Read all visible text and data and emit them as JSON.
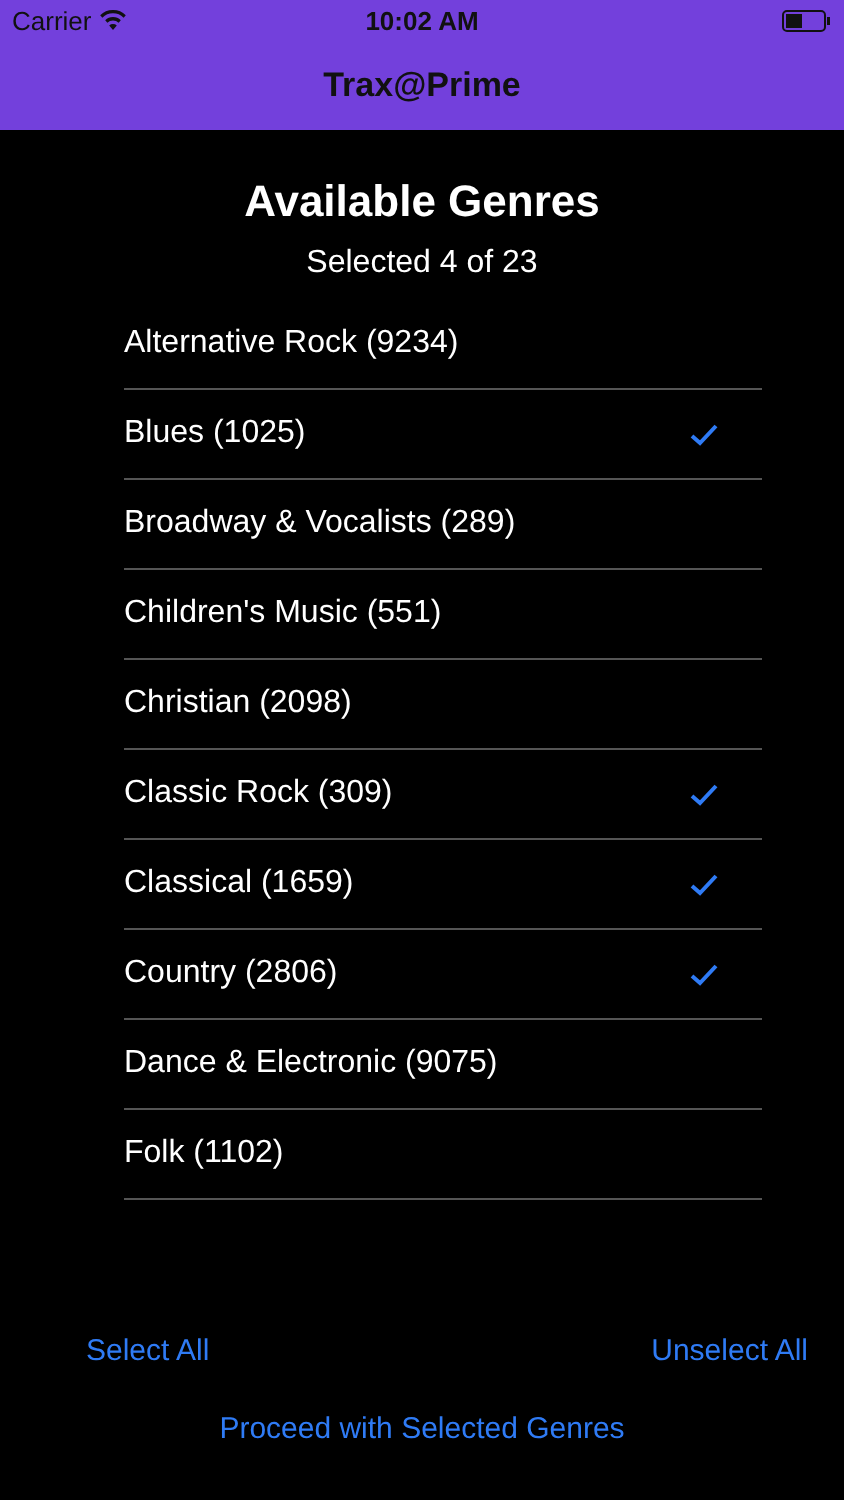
{
  "status_bar": {
    "carrier": "Carrier",
    "time": "10:02 AM"
  },
  "nav_bar": {
    "title": "Trax@Prime"
  },
  "header": {
    "title": "Available Genres",
    "subtitle": "Selected 4 of 23"
  },
  "genres": [
    {
      "label": "Alternative Rock (9234)",
      "selected": false
    },
    {
      "label": "Blues (1025)",
      "selected": true
    },
    {
      "label": "Broadway & Vocalists (289)",
      "selected": false
    },
    {
      "label": "Children's Music (551)",
      "selected": false
    },
    {
      "label": "Christian (2098)",
      "selected": false
    },
    {
      "label": "Classic Rock (309)",
      "selected": true
    },
    {
      "label": "Classical (1659)",
      "selected": true
    },
    {
      "label": "Country (2806)",
      "selected": true
    },
    {
      "label": "Dance & Electronic (9075)",
      "selected": false
    },
    {
      "label": "Folk (1102)",
      "selected": false
    }
  ],
  "actions": {
    "select_all": "Select All",
    "unselect_all": "Unselect All",
    "proceed": "Proceed with Selected Genres"
  }
}
